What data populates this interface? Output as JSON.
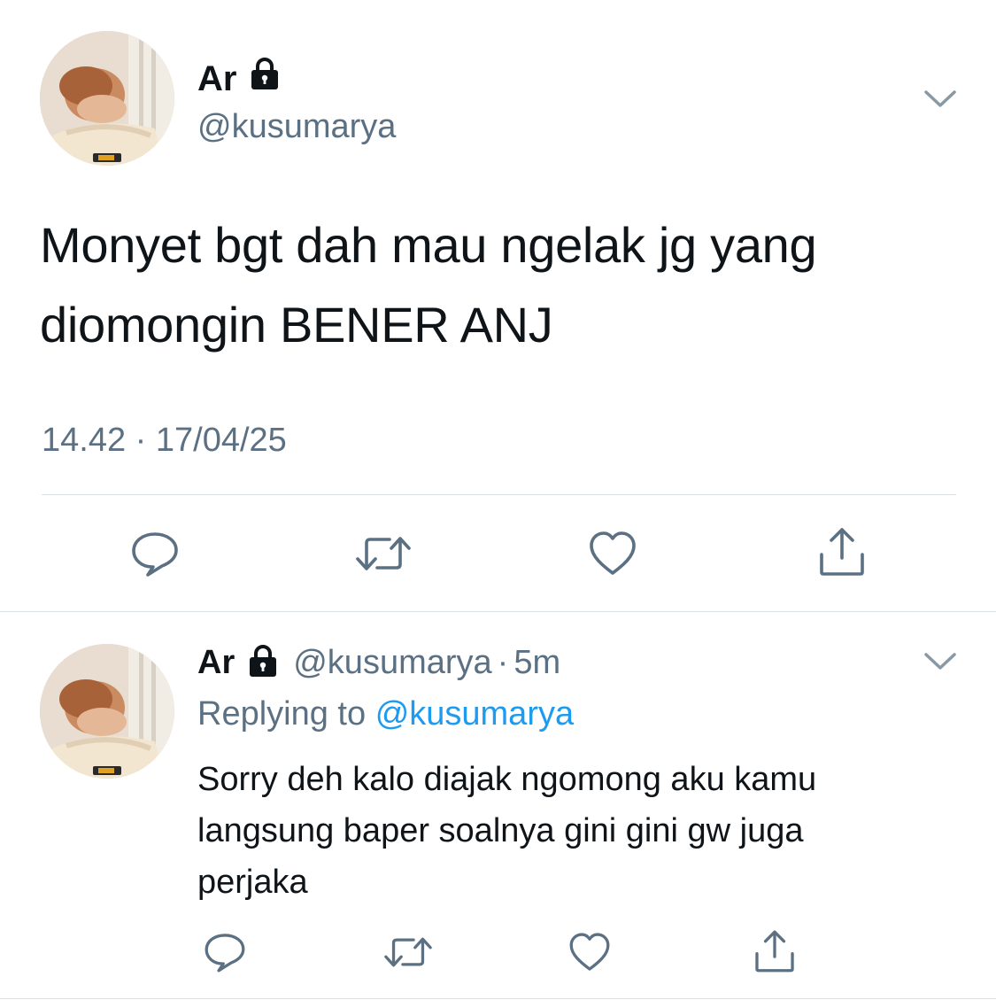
{
  "tweet": {
    "author": {
      "name": "Ar",
      "handle": "@kusumarya",
      "protected_icon": "lock-icon"
    },
    "text_line1": "Monyet bgt dah mau ngelak jg yang",
    "text_line2": "diomongin BENER ANJ",
    "timestamp": "14.42 · 17/04/25",
    "actions": [
      "reply-icon",
      "retweet-icon",
      "like-icon",
      "share-icon"
    ]
  },
  "reply": {
    "author": {
      "name": "Ar",
      "handle": "@kusumarya",
      "protected_icon": "lock-icon"
    },
    "separator": "·",
    "time": "5m",
    "replying_prefix": "Replying to",
    "replying_to": "@kusumarya",
    "text_line1": "Sorry deh kalo diajak ngomong aku kamu",
    "text_line2": "langsung baper soalnya gini gini gw juga",
    "text_line3": "perjaka",
    "actions": [
      "reply-icon",
      "retweet-icon",
      "like-icon",
      "share-icon"
    ]
  },
  "colors": {
    "text_primary": "#0f1419",
    "text_secondary": "#5b7083",
    "link": "#1d9bf0",
    "divider": "#d9dee2"
  }
}
